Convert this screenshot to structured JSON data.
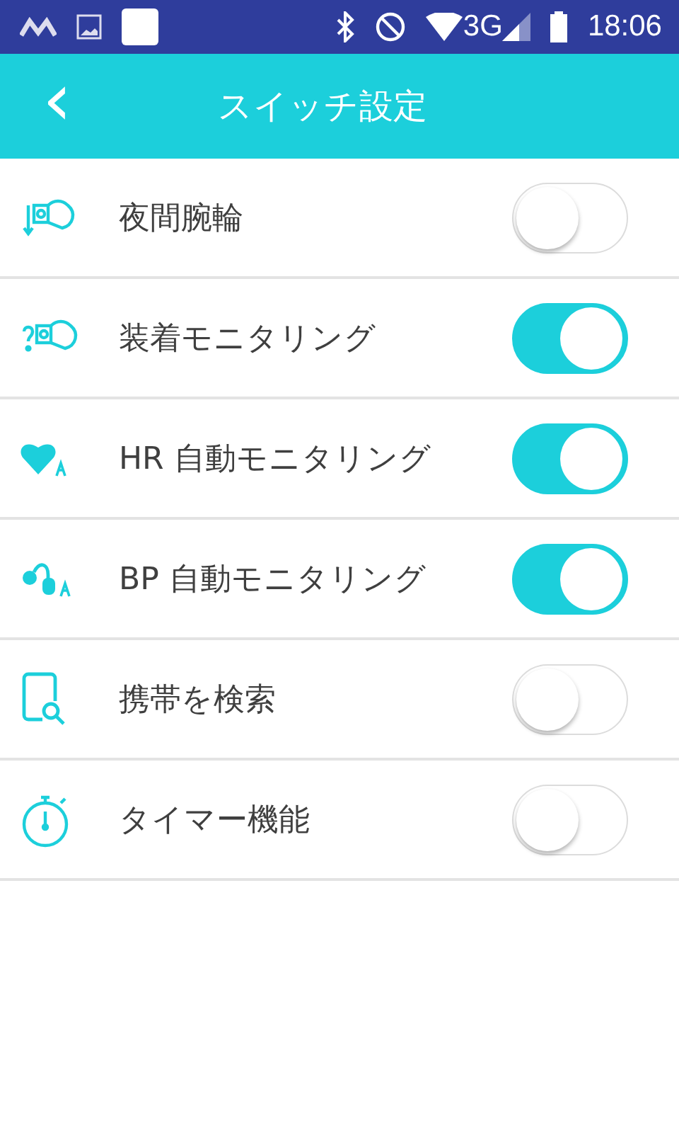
{
  "status_bar": {
    "network": "3G",
    "time": "18:06"
  },
  "header": {
    "back": "‹",
    "title": "スイッチ設定"
  },
  "settings": [
    {
      "label": "夜間腕輪",
      "on": false
    },
    {
      "label": "装着モニタリング",
      "on": true
    },
    {
      "label": "HR 自動モニタリング",
      "on": true
    },
    {
      "label": "BP 自動モニタリング",
      "on": true
    },
    {
      "label": "携帯を検索",
      "on": false
    },
    {
      "label": "タイマー機能",
      "on": false
    }
  ]
}
